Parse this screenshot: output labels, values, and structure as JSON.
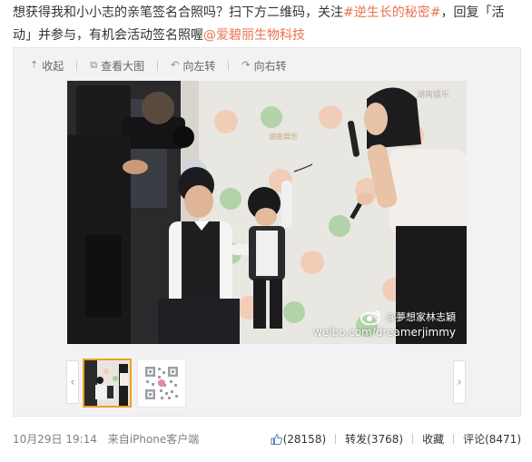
{
  "post": {
    "line1_a": "想获得我和小小志的亲笔签名合照吗？扫下方二维码，关注",
    "hashtag": "#逆生长的秘密#",
    "line1_b": "，回复「活",
    "line2_a": "动」并参与，有机会活动签名照喔",
    "mention": "@爱碧丽生物科技"
  },
  "toolbar": {
    "collapse": "收起",
    "view_large": "查看大图",
    "rotate_left": "向左转",
    "rotate_right": "向右转"
  },
  "photo": {
    "watermark_name": "@夢想家林志穎",
    "watermark_url": "weibo.com/dreamerjimmy",
    "backdrop_logo": "湖南娱乐"
  },
  "gallery": {
    "prev_arrow": "‹",
    "next_arrow": "›"
  },
  "footer": {
    "time": "10月29日 19:14",
    "from_label": "来自",
    "client": "iPhone客户端",
    "likes_count": "(28158)",
    "repost_label": "转发",
    "repost_count": "(3768)",
    "favorite_label": "收藏",
    "comment_label": "评论",
    "comment_count": "(8471)"
  },
  "colors": {
    "link": "#eb7350",
    "panel_bg": "#f2f2f5",
    "thumb_selected_border": "#f0a020"
  },
  "icons": [
    "collapse-arrow-icon",
    "view-large-icon",
    "rotate-left-icon",
    "rotate-right-icon",
    "like-thumb-icon",
    "weibo-eye-icon"
  ]
}
